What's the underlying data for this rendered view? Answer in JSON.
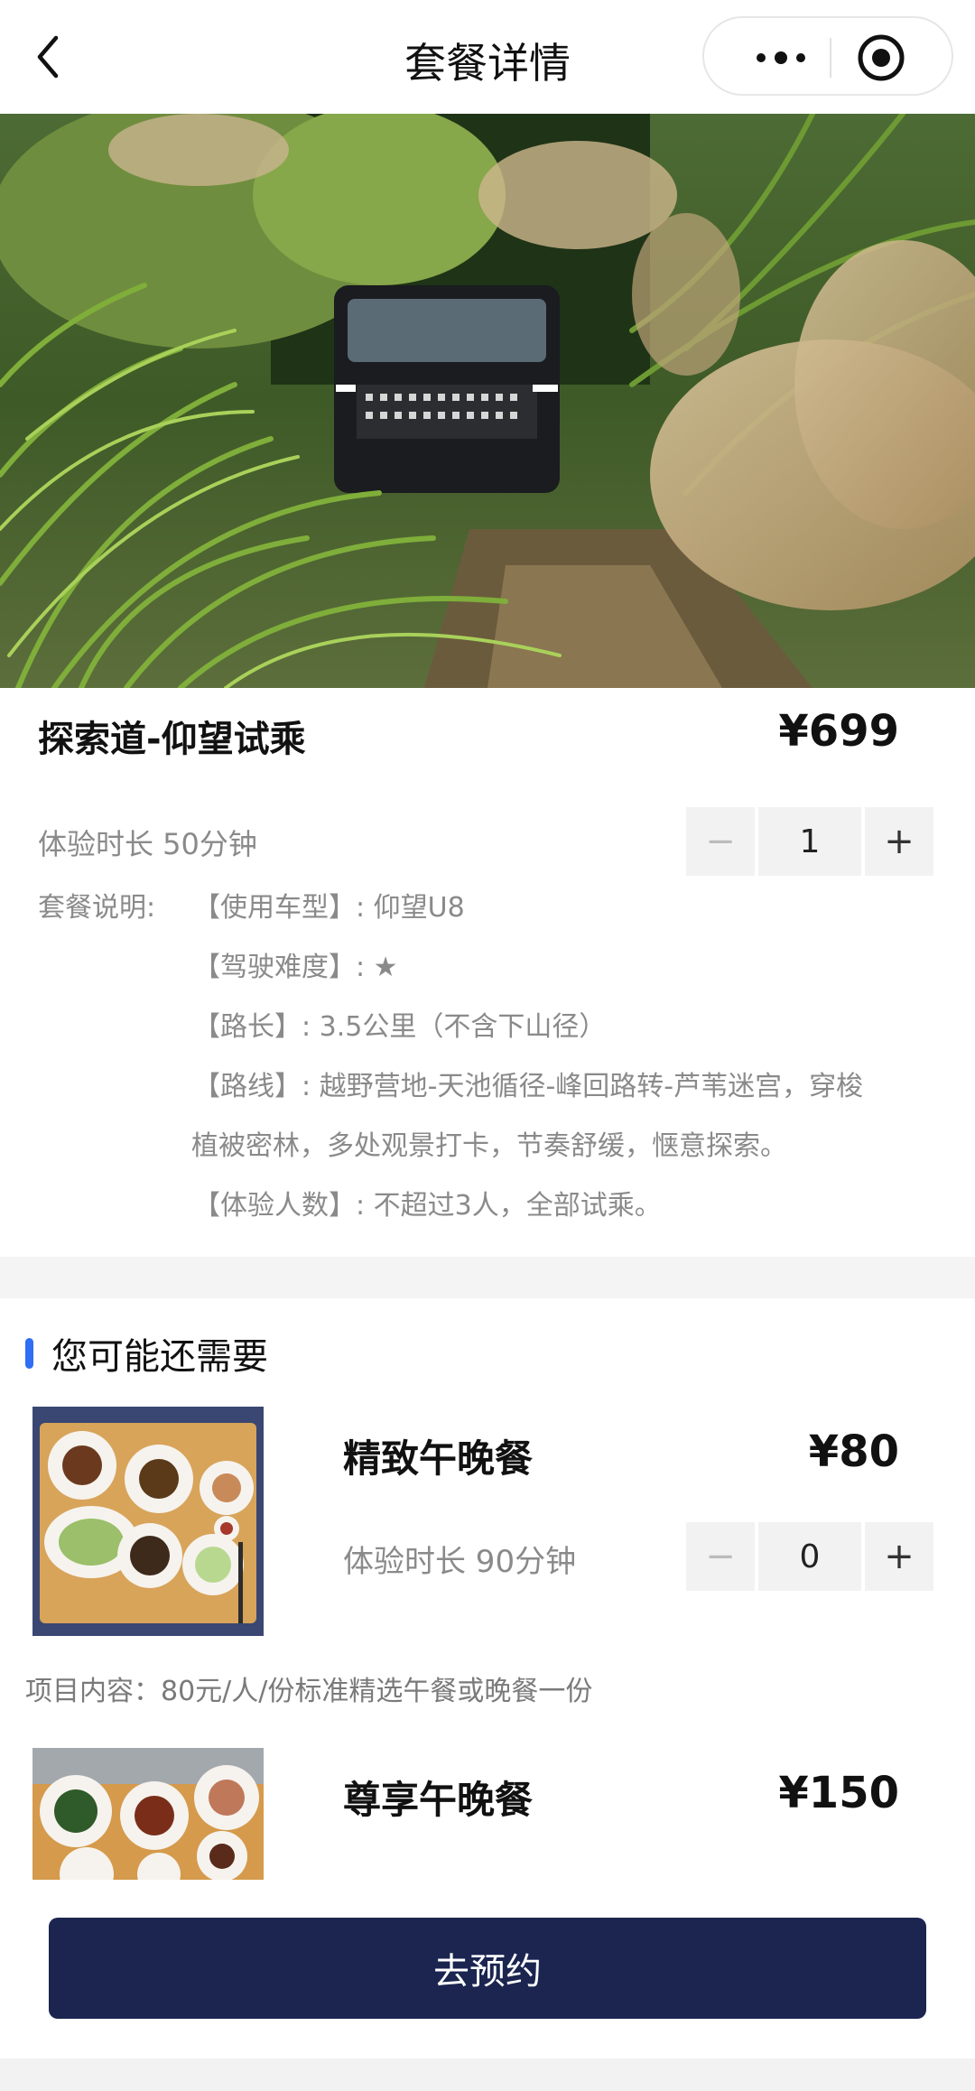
{
  "header": {
    "title": "套餐详情"
  },
  "product": {
    "name": "探索道-仰望试乘",
    "price": "¥699",
    "duration": "体验时长 50分钟",
    "quantity": "1",
    "description_label": "套餐说明:",
    "description_lines": [
      "【使用车型】: 仰望U8",
      "【驾驶难度】: ★",
      "【路长】: 3.5公里（不含下山径）",
      "【路线】: 越野营地-天池循径-峰回路转-芦苇迷宫，穿梭",
      "植被密林，多处观景打卡，节奏舒缓，惬意探索。",
      "【体验人数】: 不超过3人，全部试乘。"
    ]
  },
  "recommend": {
    "title": "您可能还需要",
    "items": [
      {
        "name": "精致午晚餐",
        "price": "¥80",
        "duration": "体验时长 90分钟",
        "quantity": "0",
        "content": "项目内容：80元/人/份标准精选午餐或晚餐一份"
      },
      {
        "name": "尊享午晚餐",
        "price": "¥150"
      }
    ]
  },
  "stepper": {
    "minus": "−",
    "plus": "+"
  },
  "footer": {
    "book_label": "去预约"
  },
  "icons": {
    "back": "chevron-left-icon",
    "more": "more-dots-icon",
    "close": "target-close-icon"
  },
  "colors": {
    "primary_button": "#1b2550",
    "accent_bar": "#2f6ef5"
  }
}
